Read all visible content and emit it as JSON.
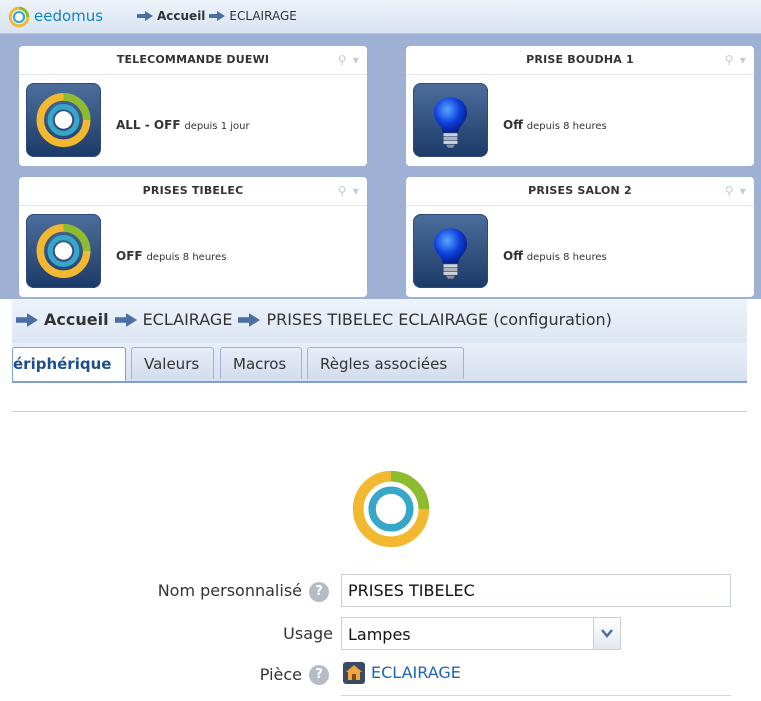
{
  "top": {
    "brand": "eedomus",
    "breadcrumb": {
      "home": "Accueil",
      "section": "ECLAIRAGE"
    },
    "cards": [
      {
        "title": "TELECOMMANDE DUEWI",
        "state": "ALL - OFF",
        "since": "depuis 1 jour",
        "icon": "eedomus-ring-icon"
      },
      {
        "title": "PRISE BOUDHA 1",
        "state": "Off",
        "since": "depuis 8 heures",
        "icon": "lightbulb-icon"
      },
      {
        "title": "PRISES TIBELEC",
        "state": "OFF",
        "since": "depuis 8 heures",
        "icon": "eedomus-ring-icon"
      },
      {
        "title": "PRISES SALON 2",
        "state": "Off",
        "since": "depuis 8 heures",
        "icon": "lightbulb-icon"
      }
    ]
  },
  "bottom": {
    "breadcrumb": {
      "home": "Accueil",
      "section": "ECLAIRAGE",
      "page": "PRISES TIBELEC ECLAIRAGE (configuration)"
    },
    "tabs": [
      {
        "label": "ériphérique",
        "active": true
      },
      {
        "label": "Valeurs",
        "active": false
      },
      {
        "label": "Macros",
        "active": false
      },
      {
        "label": "Règles associées",
        "active": false
      }
    ],
    "form": {
      "name_label": "Nom personnalisé",
      "name_value": "PRISES TIBELEC",
      "usage_label": "Usage",
      "usage_value": "Lampes",
      "room_label": "Pièce",
      "room_value": "ECLAIRAGE"
    },
    "help_glyph": "?"
  },
  "colors": {
    "accent_blue": "#1e4f8c",
    "link_blue": "#1d63b8",
    "ring_yellow": "#f2b830",
    "ring_green": "#8dbd2f",
    "ring_teal": "#36a7c9",
    "dashboard_bg": "#9fb0d5"
  }
}
